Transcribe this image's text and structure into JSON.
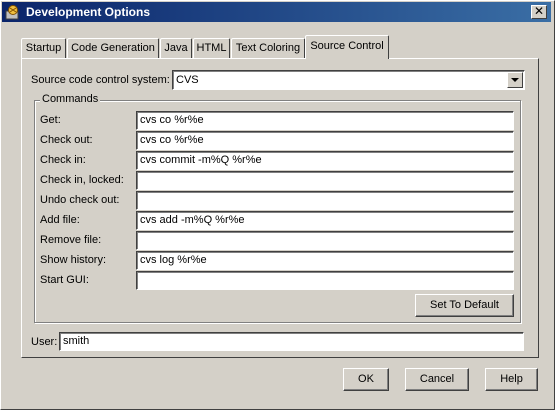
{
  "window": {
    "title": "Development Options",
    "close_glyph": "✕"
  },
  "tabs": [
    {
      "label": "Startup"
    },
    {
      "label": "Code Generation"
    },
    {
      "label": "Java"
    },
    {
      "label": "HTML"
    },
    {
      "label": "Text Coloring"
    },
    {
      "label": "Source Control",
      "active": true
    }
  ],
  "scc": {
    "label": "Source code control system:",
    "value": "CVS"
  },
  "commands": {
    "group_label": "Commands",
    "rows": [
      {
        "label": "Get:",
        "value": "cvs co %r%e"
      },
      {
        "label": "Check out:",
        "value": "cvs co %r%e"
      },
      {
        "label": "Check in:",
        "value": "cvs commit -m%Q %r%e"
      },
      {
        "label": "Check in, locked:",
        "value": ""
      },
      {
        "label": "Undo check out:",
        "value": ""
      },
      {
        "label": "Add file:",
        "value": "cvs add -m%Q %r%e"
      },
      {
        "label": "Remove file:",
        "value": ""
      },
      {
        "label": "Show history:",
        "value": "cvs log %r%e"
      },
      {
        "label": "Start GUI:",
        "value": ""
      }
    ],
    "set_default_label": "Set To Default"
  },
  "user": {
    "label": "User:",
    "value": "smith"
  },
  "buttons": {
    "ok": "OK",
    "cancel": "Cancel",
    "help": "Help"
  },
  "icons": {
    "app": "app-icon",
    "close": "close-icon",
    "dropdown": "chevron-down-icon"
  }
}
